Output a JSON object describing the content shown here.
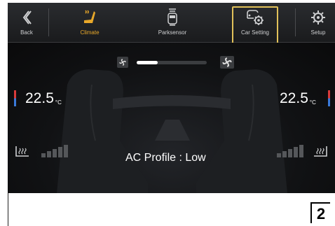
{
  "topbar": {
    "tabs": [
      {
        "label": "Back",
        "icon": "back-chevron-icon",
        "active": false
      },
      {
        "label": "Climate",
        "icon": "climate-seat-icon",
        "active": true
      },
      {
        "label": "Parksensor",
        "icon": "parksensor-car-icon",
        "active": false
      },
      {
        "label": "Car Setting",
        "icon": "car-gear-icon",
        "active": false
      },
      {
        "label": "Setup",
        "icon": "gear-icon",
        "active": false
      }
    ]
  },
  "fan": {
    "level": 0.3
  },
  "temperature": {
    "left": {
      "value": "22.5",
      "unit": "°C"
    },
    "right": {
      "value": "22.5",
      "unit": "°C"
    }
  },
  "seat_heat": {
    "left_level": 0,
    "right_level": 0
  },
  "ac_profile": {
    "text": "AC Profile : Low"
  },
  "page": {
    "number": "2"
  },
  "colors": {
    "accent": "#e8a82a",
    "highlight": "#e2c25a",
    "hot": "#d93a3a",
    "cold": "#3a7ad9"
  }
}
